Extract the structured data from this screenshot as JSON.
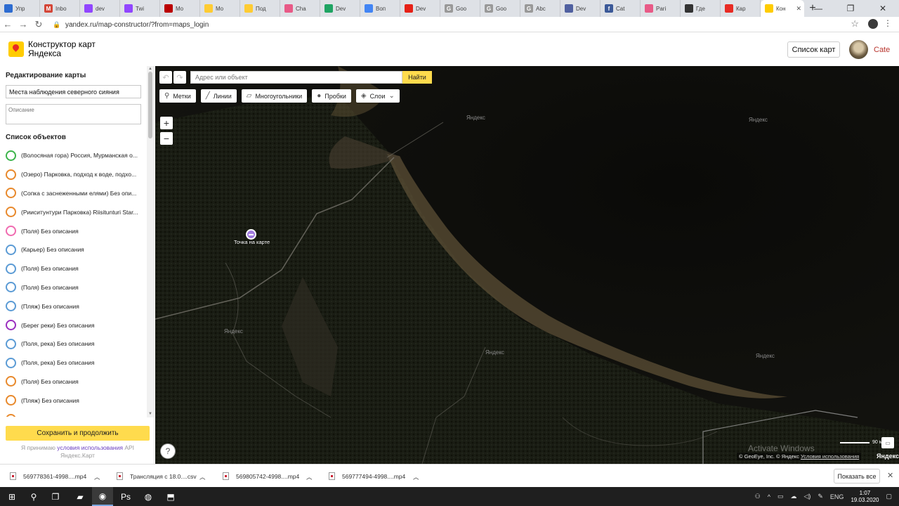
{
  "browser": {
    "tabs": [
      {
        "label": "Упр",
        "color": "#2d6cd1"
      },
      {
        "label": "Inbo",
        "color": "#d44638",
        "glyph": "M"
      },
      {
        "label": "dev",
        "color": "#9146ff"
      },
      {
        "label": "Twi",
        "color": "#9146ff"
      },
      {
        "label": "Mo",
        "color": "#b00"
      },
      {
        "label": "Mo",
        "color": "#fc3"
      },
      {
        "label": "Под",
        "color": "#fc3"
      },
      {
        "label": "Cha",
        "color": "#e85a87"
      },
      {
        "label": "Dev",
        "color": "#1fa463"
      },
      {
        "label": "Воп",
        "color": "#4285f4"
      },
      {
        "label": "Dev",
        "color": "#e62117"
      },
      {
        "label": "Goo",
        "color": "#999",
        "glyph": "G"
      },
      {
        "label": "Goo",
        "color": "#999",
        "glyph": "G"
      },
      {
        "label": "Abc",
        "color": "#999",
        "glyph": "G"
      },
      {
        "label": "Dev",
        "color": "#5060a0"
      },
      {
        "label": "Cat",
        "color": "#3b5998",
        "glyph": "f"
      },
      {
        "label": "Pari",
        "color": "#e85a87"
      },
      {
        "label": "Где",
        "color": "#333"
      },
      {
        "label": "Кар",
        "color": "#e82b24"
      }
    ],
    "active_tab": {
      "label": "Кон",
      "color": "#ffcc00"
    },
    "new_tab": "+",
    "url": "yandex.ru/map-constructor/?from=maps_login",
    "window_controls": [
      "—",
      "❐",
      "✕"
    ]
  },
  "header": {
    "title": "Конструктор карт Яндекса",
    "map_list_button": "Список карт",
    "username": "Cate"
  },
  "sidebar": {
    "title": "Редактирование карты",
    "map_name": "Места наблюдения северного сияния",
    "description_placeholder": "Описание",
    "objects_title": "Список объектов",
    "objects": [
      {
        "text": "(Волосяная гора) Россия, Мурманская о...",
        "color": "#3cb44b"
      },
      {
        "text": "(Озеро) Парковка, подход к воде, подхо...",
        "color": "#e8892c"
      },
      {
        "text": "(Сопка с заснеженными елями) Без опи...",
        "color": "#e8892c"
      },
      {
        "text": "(Рииситунтури Парковка) Riisitunturi Star...",
        "color": "#e8892c"
      },
      {
        "text": "(Поля) Без описания",
        "color": "#f06bb0"
      },
      {
        "text": "(Карьер) Без описания",
        "color": "#5b9bd5"
      },
      {
        "text": "(Поля) Без описания",
        "color": "#5b9bd5"
      },
      {
        "text": "(Поля) Без описания",
        "color": "#5b9bd5"
      },
      {
        "text": "(Пляж) Без описания",
        "color": "#5b9bd5"
      },
      {
        "text": "(Берег реки) Без описания",
        "color": "#9b2fbf"
      },
      {
        "text": "(Поля, река) Без описания",
        "color": "#5b9bd5"
      },
      {
        "text": "(Поля, река) Без описания",
        "color": "#5b9bd5"
      },
      {
        "text": "(Поля) Без описания",
        "color": "#e8892c"
      },
      {
        "text": "(Пляж) Без описания",
        "color": "#e8892c"
      },
      {
        "text": "(Холм) Без описания",
        "color": "#e8892c"
      }
    ],
    "save_button": "Сохранить и продолжить",
    "terms_prefix": "Я принимаю ",
    "terms_link": "условия использования",
    "terms_suffix": " API Яндекс.Карт"
  },
  "map": {
    "search_placeholder": "Адрес или объект",
    "find_button": "Найти",
    "tools": {
      "placemarks": "Метки",
      "lines": "Линии",
      "polygons": "Многоугольники",
      "traffic": "Пробки",
      "layers": "Слои"
    },
    "zoom_in": "+",
    "zoom_out": "−",
    "help": "?",
    "watermark": "Яндекс",
    "placemark_label": "Точка на карте",
    "scale_label": "90 м",
    "copyright_prefix": "© GeoEye, Inc. © Яндекс ",
    "copyright_link": "Условия использования",
    "logo_text": "Яндекс",
    "activate_text": "Activate Windows"
  },
  "downloads": {
    "items": [
      {
        "name": "569778361-4998....mp4"
      },
      {
        "name": "Трансляция с 18.0....csv"
      },
      {
        "name": "569805742-4998....mp4"
      },
      {
        "name": "569777494-4998....mp4"
      }
    ],
    "show_all": "Показать все",
    "close": "✕"
  },
  "taskbar": {
    "lang": "ENG",
    "time": "1:07",
    "date": "19.03.2020"
  }
}
